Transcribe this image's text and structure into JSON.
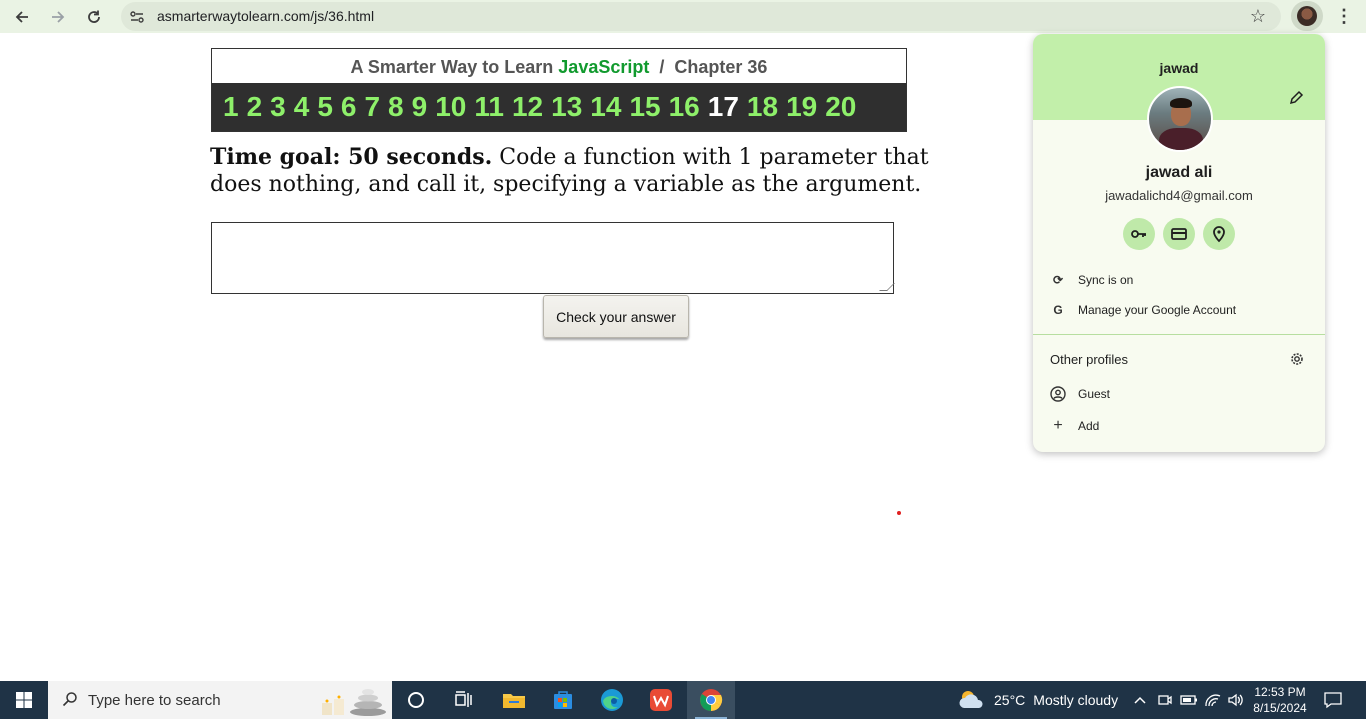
{
  "browser": {
    "url": "asmarterwaytolearn.com/js/36.html"
  },
  "page": {
    "title_prefix": "A Smarter Way to Learn",
    "title_highlight": "JavaScript",
    "title_sep": "/",
    "title_chapter": "Chapter 36",
    "chapters": [
      "1",
      "2",
      "3",
      "4",
      "5",
      "6",
      "7",
      "8",
      "9",
      "10",
      "11",
      "12",
      "13",
      "14",
      "15",
      "16",
      "17",
      "18",
      "19",
      "20"
    ],
    "current_chapter": "17",
    "goal_strong": "Time goal: 50 seconds.",
    "goal_text": "Code a function with 1 parameter that does nothing, and call it, specifying a variable as the argument.",
    "answer_value": "",
    "check_button": "Check your answer"
  },
  "profile": {
    "profile_name": "jawad",
    "full_name": "jawad ali",
    "email": "jawadalichd4@gmail.com",
    "sync": "Sync is on",
    "manage": "Manage your Google Account",
    "other_profiles": "Other profiles",
    "guest": "Guest",
    "add": "Add"
  },
  "taskbar": {
    "search_placeholder": "Type here to search",
    "weather_temp": "25°C",
    "weather_desc": "Mostly cloudy",
    "time": "12:53 PM",
    "date": "8/15/2024"
  },
  "colors": {
    "browser_bg": "#eaf3e4",
    "popup_header": "#c2efaa",
    "chapter_strip": "#2f2f2f",
    "chapter_link": "#8ef06a",
    "javascript_green": "#119a2e",
    "taskbar": "#1f3346"
  }
}
